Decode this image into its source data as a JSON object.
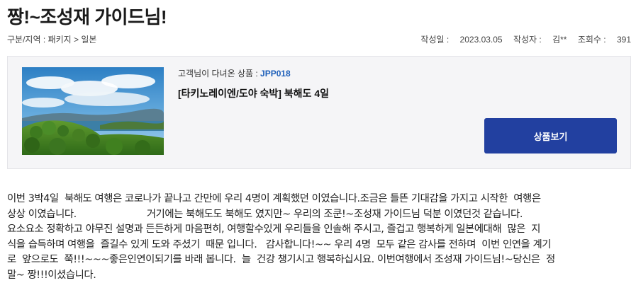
{
  "post": {
    "title": "짱!~조성재 가이드님!"
  },
  "meta": {
    "category_label": "구분/지역",
    "category_value": "패키지 > 일본",
    "date_label": "작성일",
    "date_value": "2023.03.05",
    "author_label": "작성자",
    "author_value": "김**",
    "views_label": "조회수",
    "views_value": "391"
  },
  "product": {
    "code_prefix": "고객님이 다녀온 상품 : ",
    "code": "JPP018",
    "name": "[타키노레이엔/도야 숙박] 북해도 4일",
    "view_button_label": "상품보기",
    "image_icon": "landscape-photo"
  },
  "review": {
    "lines": [
      "이번 3박4일  북해도 여행은 코로나가 끝나고 간만에 우리 4명이 계획했던 이였습니다.조금은 들뜬 기대감을 가지고 시작한  여행은",
      "상상 이였습니다.                        거기에는 북해도도 북해도 였지만~ 우리의 조쿤!~조성재 가이드님 덕분 이였던것 같습니다.",
      "요소요소 정확하고 야무진 설명과 든든하게 마음편히, 여행할수있게 우리들을 인솔해 주시고, 즐겁고 행복하게 일본에대해  많은  지",
      "식을 습득하며 여행을  즐길수 있게 도와 주셨기  때문 입니다.   감사합니다!~~ 우리 4명  모두 같은 감사를 전하며  이번 인연을 계기",
      "로  앞으로도  쭉!!!~~~좋은인연이되기를 바래 봅니다.  늘  건강 챙기시고 행복하십시요. 이번여행에서 조성재 가이드님!~당신은  정",
      "말~ 짱!!!이셨습니다."
    ]
  },
  "colors": {
    "accent": "#2240a0",
    "code": "#1d5fb9",
    "box_bg": "#f5f5f7"
  }
}
